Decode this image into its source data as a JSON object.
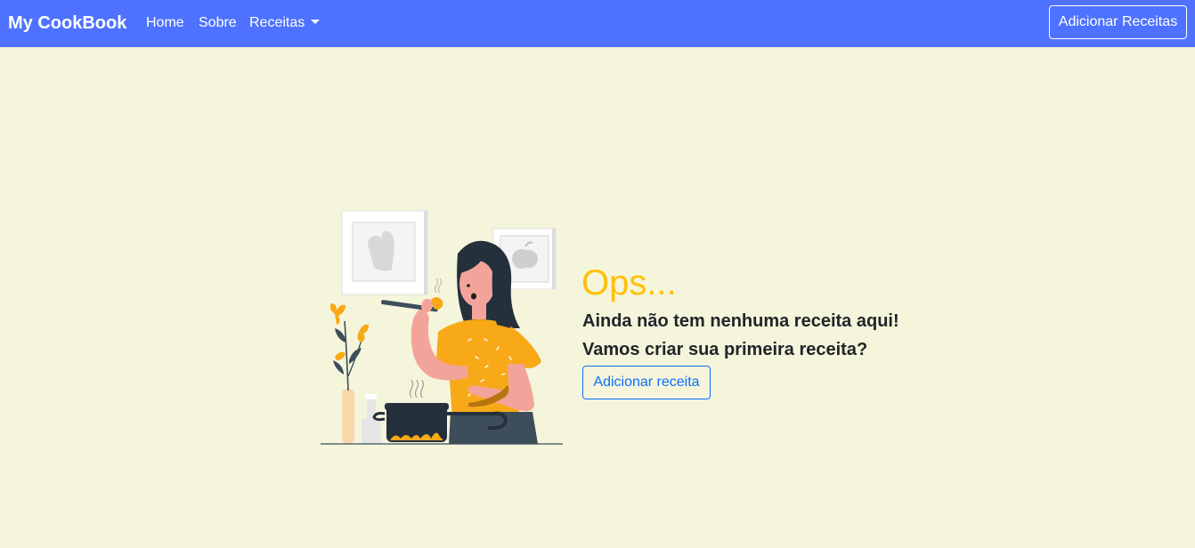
{
  "navbar": {
    "brand": "My CookBook",
    "links": [
      {
        "label": "Home"
      },
      {
        "label": "Sobre"
      },
      {
        "label": "Receitas"
      }
    ],
    "add_button_label": "Adicionar Receitas"
  },
  "empty_state": {
    "title": "Ops...",
    "message_line_1": "Ainda não tem nenhuma receita aqui!",
    "message_line_2": "Vamos criar sua primeira receita?",
    "add_button_label": "Adicionar receita"
  },
  "colors": {
    "navbar_bg": "#4E72FF",
    "page_bg": "#F5F5DC",
    "title": "#FFC107",
    "primary": "#0D6EFD",
    "text": "#212529"
  }
}
